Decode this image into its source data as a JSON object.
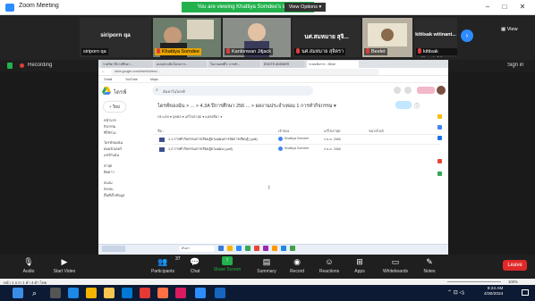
{
  "app": {
    "title": "Zoom Meeting",
    "share_banner": "You are viewing Khattiya Somdee's screen",
    "view_options": "View Options",
    "view_button": "View",
    "minimize": "–",
    "maximize": "□",
    "close": "✕",
    "sign_in": "Sign in"
  },
  "participants": [
    {
      "name": "siriporn qa",
      "label": "siriporn qa",
      "video": false
    },
    {
      "name": "",
      "label": "Khattiya Somdee",
      "video": true
    },
    {
      "name": "",
      "label": "Kanlonwan Jitjack",
      "video": true
    },
    {
      "name": "นศ.สมหมาย สุจิ...",
      "label": "นศ.สมหมาย สุจิตรา",
      "video": false
    },
    {
      "name": "",
      "label": "Beelet",
      "video": true
    },
    {
      "name": "kittisak witinant...",
      "label": "kittisak witinantakit",
      "video": false
    }
  ],
  "recording": {
    "label": "Recording"
  },
  "shared_screen": {
    "browser_tabs": [
      "รายวิชา ปีการศึกษา...",
      "แบบประเมินโครงการ...",
      "ใบงานบทที่ 1 การทำ...",
      "ENGTE ANSWER",
      "ระบบจัดการ - Drive"
    ],
    "address": "drive.google.com/drive/folders/...",
    "bookmarks": [
      "Gmail",
      "YouTube",
      "Maps"
    ],
    "drive": {
      "title": "ไดรฟ์",
      "search_placeholder": "ค้นหาในไดรฟ์",
      "new_button": "+ ใหม่",
      "sidebar": [
        "หน้าแรก",
        "กิจกรรม",
        "ที่ใช้ร่วม",
        "ไดรฟ์ของฉัน",
        "คอมพิวเตอร์",
        "แชร์กับฉัน",
        "ล่าสุด",
        "ติดดาว",
        "สแปม",
        "ถังขยะ",
        "พื้นที่เก็บข้อมูล"
      ],
      "breadcrumb": "ไดรฟ์ของฉัน > ... > 4.3A ปีการศึกษา 256 ... > ผลงานประจำเทอม 1 การทำกิจกรรม ▾",
      "filters": "ประเภท ▾   บุคคล ▾   แก้ไขล่าสุด ▾   แหล่งที่มา ▾",
      "columns": {
        "name": "ชื่อ ↑",
        "owner": "เจ้าของ",
        "date": "แก้ไขล่าสุด",
        "size": "ขนาดไฟล์"
      },
      "files": [
        {
          "name": "1.1 การทำกิจกรรมการเรียนรู้ตามแผนการจัดการเรียนรู้ (.pdf)",
          "owner": "Khattiya Somdee",
          "date": "4 ต.ค. 2566"
        },
        {
          "name": "1.2 การทำกิจกรรมการเรียนรู้ตามแผน (.pdf)",
          "owner": "Khattiya Somdee",
          "date": "4 ต.ค. 2566"
        }
      ],
      "taskbar_search": "ค้นหา"
    }
  },
  "toolbar": {
    "audio": "Audio",
    "start_video": "Start Video",
    "participants": "Participants",
    "participants_count": "37",
    "chat": "Chat",
    "share_screen": "Share Screen",
    "summary": "Summary",
    "record": "Record",
    "reactions": "Reactions",
    "apps": "Apps",
    "whiteboards": "Whiteboards",
    "notes": "Notes",
    "leave": "Leave"
  },
  "statusbar": {
    "left": "หน้า 1 จาก 1   คำ 4 คำ   ไทย",
    "zoom": "100%"
  },
  "clock": {
    "time": "9:24 AM",
    "date": "4/30/2024"
  },
  "colors": {
    "accent": "#2d8cff",
    "share_green": "#22b14c",
    "leave_red": "#e02828"
  }
}
